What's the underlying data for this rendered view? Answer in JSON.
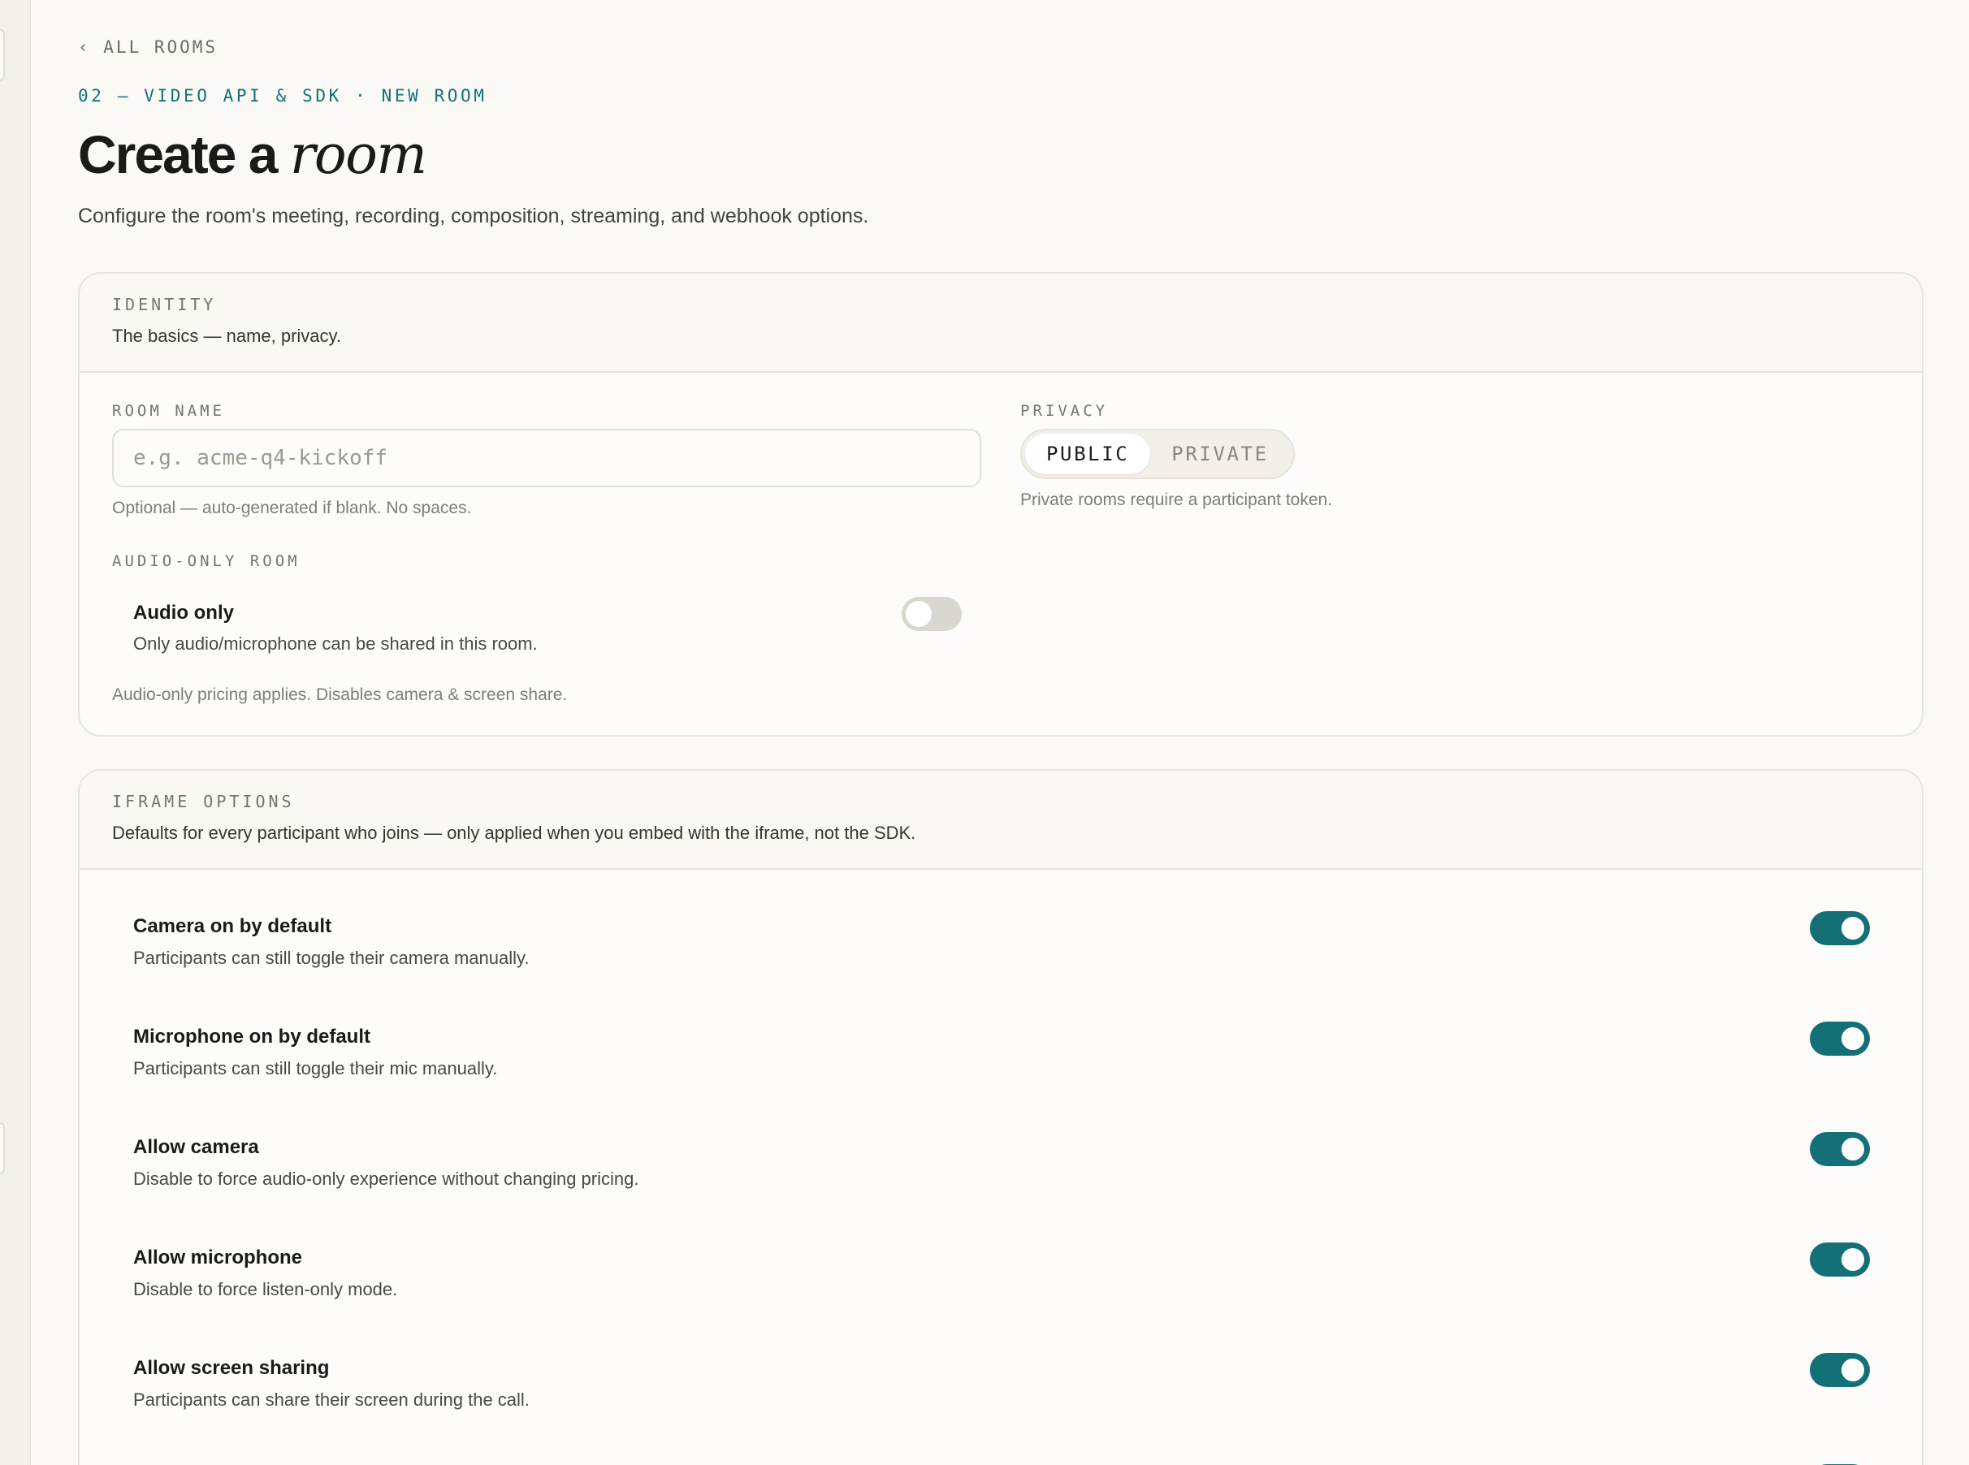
{
  "nav": {
    "back_label": "‹ ALL ROOMS"
  },
  "header": {
    "eyebrow": "02 — VIDEO API & SDK · NEW ROOM",
    "title_plain": "Create a",
    "title_italic": "room",
    "subtitle": "Configure the room's meeting, recording, composition, streaming, and webhook options."
  },
  "identity": {
    "label": "IDENTITY",
    "description": "The basics — name, privacy.",
    "room_name": {
      "label": "ROOM NAME",
      "value": "",
      "placeholder": "e.g. acme-q4-kickoff",
      "helper": "Optional — auto-generated if blank. No spaces."
    },
    "privacy": {
      "label": "PRIVACY",
      "options": [
        "PUBLIC",
        "PRIVATE"
      ],
      "selected": "PUBLIC",
      "helper": "Private rooms require a participant token."
    },
    "audio_only": {
      "label": "AUDIO-ONLY ROOM",
      "title": "Audio only",
      "description": "Only audio/microphone can be shared in this room.",
      "enabled": false,
      "note": "Audio-only pricing applies. Disables camera & screen share."
    }
  },
  "iframe_options": {
    "label": "IFRAME OPTIONS",
    "description": "Defaults for every participant who joins — only applied when you embed with the iframe, not the SDK.",
    "rows": [
      {
        "title": "Camera on by default",
        "description": "Participants can still toggle their camera manually.",
        "enabled": true
      },
      {
        "title": "Microphone on by default",
        "description": "Participants can still toggle their mic manually.",
        "enabled": true
      },
      {
        "title": "Allow camera",
        "description": "Disable to force audio-only experience without changing pricing.",
        "enabled": true
      },
      {
        "title": "Allow microphone",
        "description": "Disable to force listen-only mode.",
        "enabled": true
      },
      {
        "title": "Allow screen sharing",
        "description": "Participants can share their screen during the call.",
        "enabled": true
      }
    ]
  },
  "colors": {
    "accent": "#147077",
    "background": "#faf9f6",
    "toggle_off": "#dad7d0"
  }
}
